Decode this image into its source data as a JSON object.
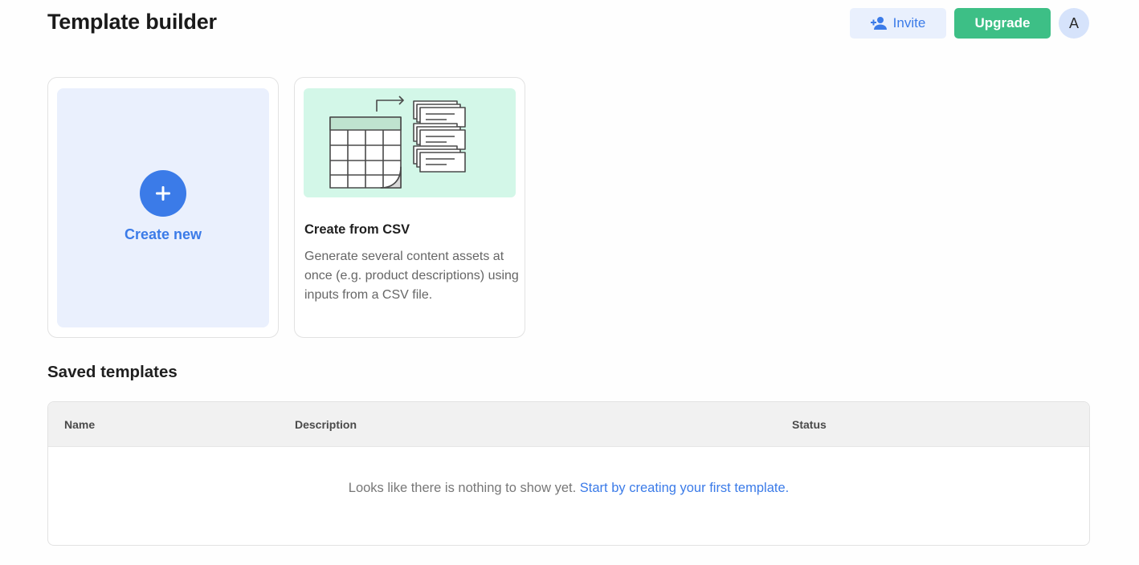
{
  "header": {
    "title": "Template builder",
    "invite_label": "Invite",
    "upgrade_label": "Upgrade",
    "avatar_initial": "A"
  },
  "colors": {
    "accent_blue": "#3b7be8",
    "accent_green": "#3dbf86",
    "card_blue_bg": "#eaf0fd",
    "card_green_bg": "#d3f7e8"
  },
  "cards": {
    "create_new": {
      "label": "Create new",
      "icon": "plus-icon"
    },
    "csv": {
      "title": "Create from CSV",
      "description": "Generate several content assets at once (e.g. product descriptions) using inputs from a CSV file.",
      "icon": "csv-illustration"
    }
  },
  "saved_templates": {
    "title": "Saved templates",
    "columns": [
      "Name",
      "Description",
      "Status"
    ],
    "rows": [],
    "empty_text": "Looks like there is nothing to show yet.",
    "empty_link": "Start by creating your first template."
  }
}
